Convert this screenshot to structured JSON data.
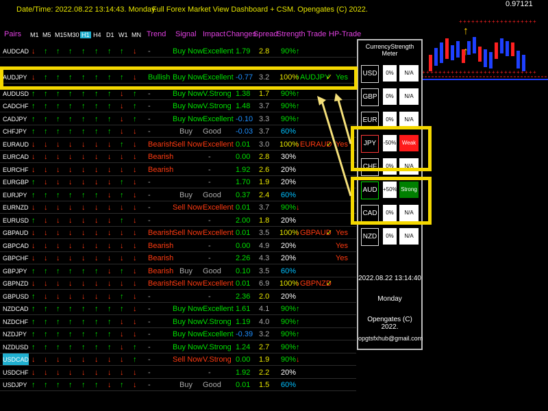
{
  "header": {
    "datetime": "Date/Time:  2022.08.22 13:14:43. Monday.",
    "title": "Full Forex Market View Dashboard + CSM. Opengates (C) 2022.",
    "price_label": "0.97121"
  },
  "columns": {
    "pairs": "Pairs",
    "timeframes": [
      "M1",
      "M5",
      "M15",
      "M30",
      "H1",
      "H4",
      "D1",
      "W1",
      "MN"
    ],
    "trend": "Trend",
    "signal": "Signal",
    "impact": "Impact",
    "changes": "Changes",
    "spread": "Spread",
    "strength": "Strength",
    "trade": "Trade",
    "hp_trade": "HP-Trade"
  },
  "colors": {
    "up": "#00e000",
    "down": "#ff3a10",
    "highlight": "#f5d800",
    "weak": "#ff1a1a",
    "strong": "#008000"
  },
  "rows": [
    {
      "pair": "AUDCAD",
      "tf": "duuuuuuud",
      "trend": "-",
      "signal": "Buy Now",
      "impact": "Excellent",
      "change": "1.79",
      "spread": "2.8",
      "strength": "90%",
      "strength_dir": "u",
      "trade": "",
      "hp": ""
    },
    {
      "pair": "AUDJPY",
      "tf": "duuuuuuud",
      "trend": "Bullish",
      "signal": "Buy Now",
      "impact": "Excellent",
      "change": "-0.77",
      "spread": "3.2",
      "strength": "100%",
      "strength_dir": "u",
      "trade": "AUDJPY",
      "hp": "Yes",
      "hl": true
    },
    {
      "pair": "AUDUSD",
      "tf": "uuuuuuudu",
      "trend": "-",
      "signal": "Buy Now",
      "impact": "V.Strong",
      "change": "1.38",
      "spread": "1.7",
      "strength": "90%",
      "strength_dir": "u",
      "trade": "",
      "hp": ""
    },
    {
      "pair": "CADCHF",
      "tf": "uuuuuuudu",
      "trend": "-",
      "signal": "Buy Now",
      "impact": "V.Strong",
      "change": "1.48",
      "spread": "3.7",
      "strength": "90%",
      "strength_dir": "u",
      "trade": "",
      "hp": ""
    },
    {
      "pair": "CADJPY",
      "tf": "uuuuuuudu",
      "trend": "-",
      "signal": "Buy Now",
      "impact": "Excellent",
      "change": "-0.10",
      "spread": "3.3",
      "strength": "90%",
      "strength_dir": "u",
      "trade": "",
      "hp": ""
    },
    {
      "pair": "CHFJPY",
      "tf": "uuuuuuudd",
      "trend": "-",
      "signal": "Buy",
      "impact": "Good",
      "change": "-0.03",
      "spread": "3.7",
      "strength": "60%",
      "strength_dir": "",
      "trade": "",
      "hp": ""
    },
    {
      "pair": "EURAUD",
      "tf": "dddddddud",
      "trend": "Bearish",
      "signal": "Sell Now",
      "impact": "Excellent",
      "change": "0.01",
      "spread": "3.0",
      "strength": "100%",
      "strength_dir": "d",
      "trade": "EURAUD",
      "hp": "Yes"
    },
    {
      "pair": "EURCAD",
      "tf": "ddddddddd",
      "trend": "Bearish",
      "signal": "",
      "impact": "-",
      "change": "0.00",
      "spread": "2.8",
      "strength": "30%",
      "strength_dir": "",
      "trade": "",
      "hp": ""
    },
    {
      "pair": "EURCHF",
      "tf": "ddddddddd",
      "trend": "Bearish",
      "signal": "",
      "impact": "-",
      "change": "1.92",
      "spread": "2.6",
      "strength": "20%",
      "strength_dir": "",
      "trade": "",
      "hp": ""
    },
    {
      "pair": "EURGBP",
      "tf": "uddddddud",
      "trend": "-",
      "signal": "",
      "impact": "-",
      "change": "1.70",
      "spread": "1.9",
      "strength": "20%",
      "strength_dir": "",
      "trade": "",
      "hp": ""
    },
    {
      "pair": "EURJPY",
      "tf": "uuuuuudud",
      "trend": "-",
      "signal": "Buy",
      "impact": "Good",
      "change": "0.37",
      "spread": "2.4",
      "strength": "60%",
      "strength_dir": "",
      "trade": "",
      "hp": ""
    },
    {
      "pair": "EURNZD",
      "tf": "ddddddddd",
      "trend": "-",
      "signal": "Sell Now",
      "impact": "Excellent",
      "change": "0.01",
      "spread": "3.7",
      "strength": "90%",
      "strength_dir": "d",
      "trade": "",
      "hp": ""
    },
    {
      "pair": "EURUSD",
      "tf": "uddddddud",
      "trend": "-",
      "signal": "",
      "impact": "-",
      "change": "2.00",
      "spread": "1.8",
      "strength": "20%",
      "strength_dir": "",
      "trade": "",
      "hp": ""
    },
    {
      "pair": "GBPAUD",
      "tf": "ddddddddd",
      "trend": "Bearish",
      "signal": "Sell Now",
      "impact": "Excellent",
      "change": "0.01",
      "spread": "3.5",
      "strength": "100%",
      "strength_dir": "d",
      "trade": "GBPAUD",
      "hp": "Yes"
    },
    {
      "pair": "GBPCAD",
      "tf": "ddddddddd",
      "trend": "Bearish",
      "signal": "",
      "impact": "-",
      "change": "0.00",
      "spread": "4.9",
      "strength": "20%",
      "strength_dir": "",
      "trade": "",
      "hp": "Yes"
    },
    {
      "pair": "GBPCHF",
      "tf": "ddddddddd",
      "trend": "Bearish",
      "signal": "",
      "impact": "-",
      "change": "2.26",
      "spread": "4.3",
      "strength": "20%",
      "strength_dir": "",
      "trade": "",
      "hp": "Yes"
    },
    {
      "pair": "GBPJPY",
      "tf": "uuuuuudud",
      "trend": "Bearish",
      "signal": "Buy",
      "impact": "Good",
      "change": "0.10",
      "spread": "3.5",
      "strength": "60%",
      "strength_dir": "",
      "trade": "",
      "hp": ""
    },
    {
      "pair": "GBPNZD",
      "tf": "ddddddddd",
      "trend": "Bearish",
      "signal": "Sell Now",
      "impact": "Excellent",
      "change": "0.01",
      "spread": "6.9",
      "strength": "100%",
      "strength_dir": "d",
      "trade": "GBPNZD",
      "hp": ""
    },
    {
      "pair": "GBPUSD",
      "tf": "uddddddud",
      "trend": "-",
      "signal": "",
      "impact": "-",
      "change": "2.36",
      "spread": "2.0",
      "strength": "20%",
      "strength_dir": "",
      "trade": "",
      "hp": ""
    },
    {
      "pair": "NZDCAD",
      "tf": "uuuuuuuud",
      "trend": "-",
      "signal": "Buy Now",
      "impact": "Excellent",
      "change": "1.61",
      "spread": "4.1",
      "strength": "90%",
      "strength_dir": "u",
      "trade": "",
      "hp": ""
    },
    {
      "pair": "NZDCHF",
      "tf": "uuuuuuudd",
      "trend": "-",
      "signal": "Buy Now",
      "impact": "V.Strong",
      "change": "1.19",
      "spread": "4.0",
      "strength": "90%",
      "strength_dir": "u",
      "trade": "",
      "hp": ""
    },
    {
      "pair": "NZDJPY",
      "tf": "uuuuuuudd",
      "trend": "-",
      "signal": "Buy Now",
      "impact": "Excellent",
      "change": "-0.39",
      "spread": "3.2",
      "strength": "90%",
      "strength_dir": "u",
      "trade": "",
      "hp": ""
    },
    {
      "pair": "NZDUSD",
      "tf": "uuuuuuudu",
      "trend": "-",
      "signal": "Buy Now",
      "impact": "V.Strong",
      "change": "1.24",
      "spread": "2.7",
      "strength": "90%",
      "strength_dir": "u",
      "trade": "",
      "hp": ""
    },
    {
      "pair": "USDCAD",
      "tf": "ddddddddu",
      "trend": "-",
      "signal": "Sell Now",
      "impact": "V.Strong",
      "change": "0.00",
      "spread": "1.9",
      "strength": "90%",
      "strength_dir": "d",
      "trade": "",
      "hp": "",
      "sel": true
    },
    {
      "pair": "USDCHF",
      "tf": "ddddddddd",
      "trend": "-",
      "signal": "",
      "impact": "-",
      "change": "1.92",
      "spread": "2.2",
      "strength": "20%",
      "strength_dir": "",
      "trade": "",
      "hp": ""
    },
    {
      "pair": "USDJPY",
      "tf": "uuuuuudud",
      "trend": "-",
      "signal": "Buy",
      "impact": "Good",
      "change": "0.01",
      "spread": "1.5",
      "strength": "60%",
      "strength_dir": "",
      "trade": "",
      "hp": ""
    }
  ],
  "meter": {
    "title": "CurrencyStrength Meter",
    "currencies": [
      {
        "code": "USD",
        "pct": "0%",
        "state": "N/A"
      },
      {
        "code": "GBP",
        "pct": "0%",
        "state": "N/A"
      },
      {
        "code": "EUR",
        "pct": "0%",
        "state": "N/A"
      },
      {
        "code": "JPY",
        "pct": "-50%",
        "state": "Weak"
      },
      {
        "code": "CHF",
        "pct": "0%",
        "state": "N/A"
      },
      {
        "code": "AUD",
        "pct": "+50%",
        "state": "Strong"
      },
      {
        "code": "CAD",
        "pct": "0%",
        "state": "N/A"
      },
      {
        "code": "NZD",
        "pct": "0%",
        "state": "N/A"
      }
    ],
    "datetime": "2022.08.22 13:14:40",
    "day": "Monday",
    "copyright": "Opengates (C) 2022.",
    "email": "opgtsfxhub@gmail.com"
  }
}
